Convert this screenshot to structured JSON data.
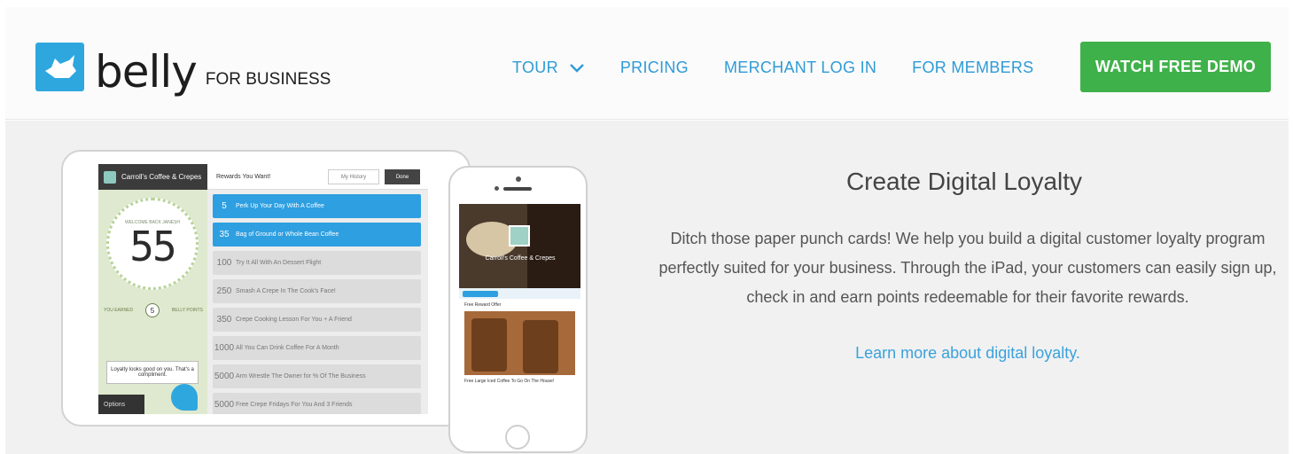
{
  "header": {
    "logo_word": "belly",
    "logo_sub": "FOR BUSINESS",
    "logo_icon": "dog-icon"
  },
  "nav": {
    "tour": "TOUR",
    "pricing": "PRICING",
    "merchant_login": "MERCHANT LOG IN",
    "for_members": "FOR MEMBERS",
    "watch_demo": "WATCH FREE DEMO"
  },
  "colors": {
    "brand_blue": "#2ea7df",
    "nav_blue": "#2f9bd6",
    "cta_green": "#3fb14a"
  },
  "hero": {
    "title": "Create Digital Loyalty",
    "body": "Ditch those paper punch cards! We help you build a digital customer loyalty program perfectly suited for your business. Through the iPad, your customers can easily sign up, check in and earn points redeemable for their favorite rewards.",
    "link": "Learn more about digital loyalty."
  },
  "ipad": {
    "business_name": "Carroll's Coffee & Crepes",
    "welcome": "WELCOME BACK JANESH",
    "points": "55",
    "you_earned": "YOU EARNED",
    "earned_pts": "5",
    "belly_points": "BELLY POINTS",
    "loyalty_msg": "Loyalty looks good on you. That's a compliment.",
    "options": "Options",
    "rewards_title": "Rewards You Want!",
    "history": "My History",
    "done": "Done",
    "rewards": [
      {
        "pts": "5",
        "label": "Perk Up Your Day With A Coffee",
        "state": "on"
      },
      {
        "pts": "35",
        "label": "Bag of Ground or Whole Bean Coffee",
        "state": "on"
      },
      {
        "pts": "100",
        "label": "Try It All With An Dessert Flight",
        "state": "off"
      },
      {
        "pts": "250",
        "label": "Smash A Crepe In The Cook's Face!",
        "state": "off"
      },
      {
        "pts": "350",
        "label": "Crepe Cooking Lesson For You + A Friend",
        "state": "off"
      },
      {
        "pts": "1000",
        "label": "All You Can Drink Coffee For A Month",
        "state": "off"
      },
      {
        "pts": "5000",
        "label": "Arm Wrestle The Owner for % Of The Business",
        "state": "off"
      },
      {
        "pts": "5000",
        "label": "Free Crepe Fridays For You And 3 Friends",
        "state": "off"
      }
    ]
  },
  "iphone": {
    "business_name": "Carroll's Coffee & Crepes",
    "free_rewards": "Free Reward Offer",
    "caption": "Free Large Iced Coffee To Go On The House!"
  }
}
